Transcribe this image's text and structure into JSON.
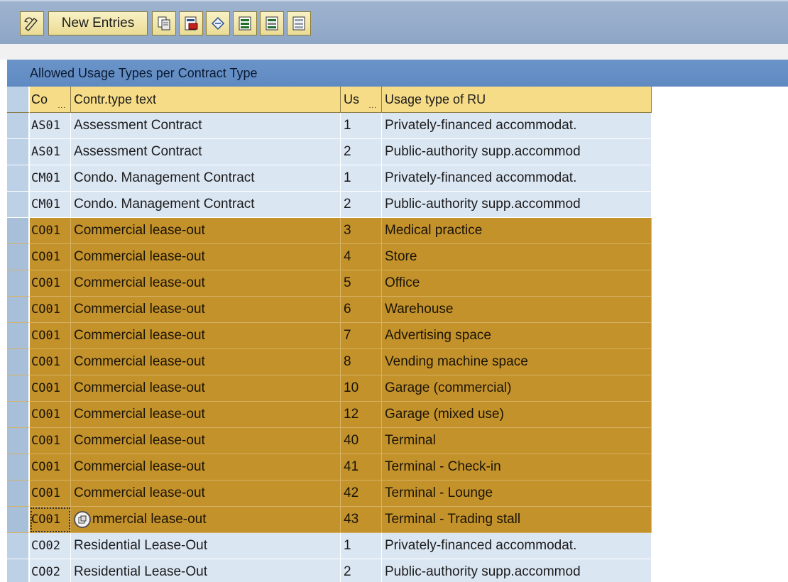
{
  "toolbar": {
    "new_entries_label": "New Entries",
    "icons": [
      "change-display-icon",
      "copy-as-icon",
      "delete-icon",
      "undo-change-icon",
      "select-all-icon",
      "select-block-icon",
      "deselect-all-icon"
    ]
  },
  "table": {
    "title": "Allowed Usage Types per Contract Type",
    "headers": {
      "code": "Co",
      "contract_text": "Contr.type text",
      "usage": "Us",
      "usage_text": "Usage type of RU"
    },
    "rows": [
      {
        "code": "AS01",
        "text": "Assessment Contract",
        "us": "1",
        "usage": "Privately-financed accommodat.",
        "selected": false
      },
      {
        "code": "AS01",
        "text": "Assessment Contract",
        "us": "2",
        "usage": "Public-authority supp.accommod",
        "selected": false
      },
      {
        "code": "CM01",
        "text": "Condo. Management Contract",
        "us": "1",
        "usage": "Privately-financed accommodat.",
        "selected": false
      },
      {
        "code": "CM01",
        "text": "Condo. Management Contract",
        "us": "2",
        "usage": "Public-authority supp.accommod",
        "selected": false
      },
      {
        "code": "CO01",
        "text": "Commercial lease-out",
        "us": "3",
        "usage": "Medical practice",
        "selected": true
      },
      {
        "code": "CO01",
        "text": "Commercial lease-out",
        "us": "4",
        "usage": "Store",
        "selected": true
      },
      {
        "code": "CO01",
        "text": "Commercial lease-out",
        "us": "5",
        "usage": "Office",
        "selected": true
      },
      {
        "code": "CO01",
        "text": "Commercial lease-out",
        "us": "6",
        "usage": "Warehouse",
        "selected": true
      },
      {
        "code": "CO01",
        "text": "Commercial lease-out",
        "us": "7",
        "usage": "Advertising space",
        "selected": true
      },
      {
        "code": "CO01",
        "text": "Commercial lease-out",
        "us": "8",
        "usage": "Vending machine space",
        "selected": true
      },
      {
        "code": "CO01",
        "text": "Commercial lease-out",
        "us": "10",
        "usage": "Garage (commercial)",
        "selected": true
      },
      {
        "code": "CO01",
        "text": "Commercial lease-out",
        "us": "12",
        "usage": "Garage (mixed use)",
        "selected": true
      },
      {
        "code": "CO01",
        "text": "Commercial lease-out",
        "us": "40",
        "usage": "Terminal",
        "selected": true
      },
      {
        "code": "CO01",
        "text": "Commercial lease-out",
        "us": "41",
        "usage": "Terminal - Check-in",
        "selected": true
      },
      {
        "code": "CO01",
        "text": "Commercial lease-out",
        "us": "42",
        "usage": "Terminal - Lounge",
        "selected": true
      },
      {
        "code": "CO01",
        "text": "mmercial lease-out",
        "us": "43",
        "usage": "Terminal - Trading stall",
        "selected": true,
        "focused": true
      },
      {
        "code": "CO02",
        "text": "Residential Lease-Out",
        "us": "1",
        "usage": "Privately-financed accommodat.",
        "selected": false
      },
      {
        "code": "CO02",
        "text": "Residential Lease-Out",
        "us": "2",
        "usage": "Public-authority supp.accommod",
        "selected": false
      }
    ]
  },
  "colors": {
    "toolbar_bg": "#8ea6c6",
    "title_bar": "#5f8ac1",
    "header_cell": "#f6dc86",
    "row_unselected": "#dbe6f3",
    "row_selected": "#c4922b"
  }
}
